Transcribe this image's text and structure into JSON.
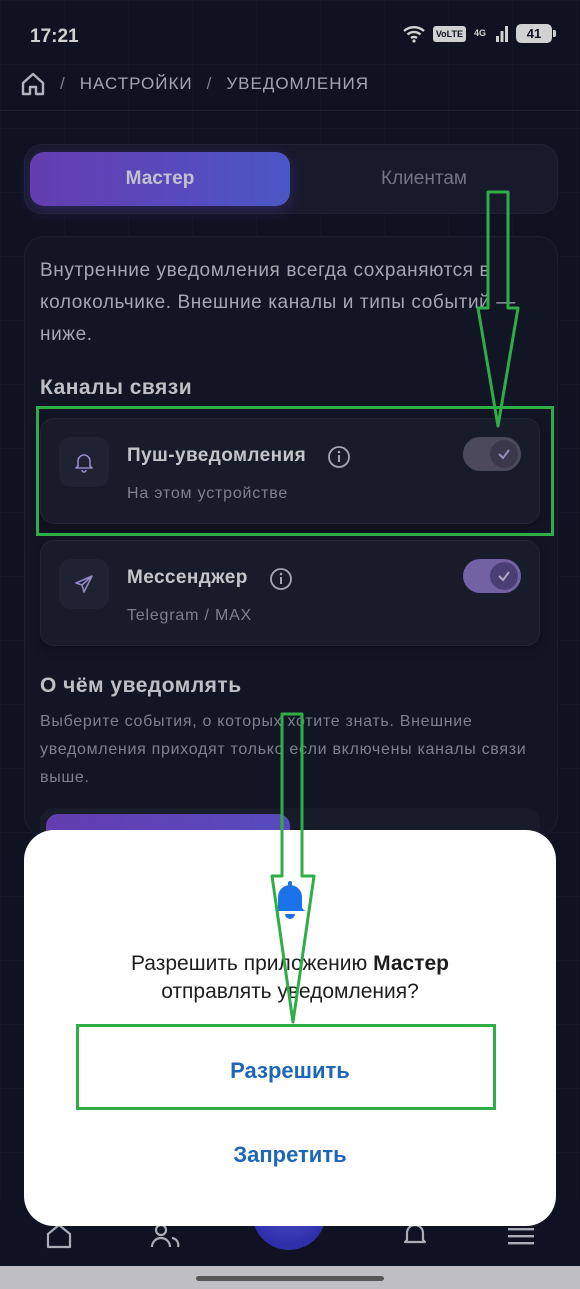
{
  "status_bar": {
    "time": "17:21",
    "volte": "VoLTE",
    "network": "4G",
    "battery": "41"
  },
  "breadcrumb": {
    "home_icon": "home-icon",
    "separator": "/",
    "items": [
      "НАСТРОЙКИ",
      "УВЕДОМЛЕНИЯ"
    ]
  },
  "tabs": [
    {
      "label": "Мастер",
      "active": true
    },
    {
      "label": "Клиентам",
      "active": false
    }
  ],
  "intro_text": "Внутренние уведомления всегда сохраняются в колокольчике. Внешние каналы и типы событий — ниже.",
  "channels": {
    "title": "Каналы связи",
    "items": [
      {
        "icon": "bell-icon",
        "title": "Пуш-уведомления",
        "subtitle": "На этом устройстве",
        "enabled": true
      },
      {
        "icon": "send-icon",
        "title": "Мессенджер",
        "subtitle": "Telegram / MAX",
        "enabled": true
      }
    ]
  },
  "events": {
    "title": "О чём уведомлять",
    "description": "Выберите события, о которых хотите знать. Внешние уведомления приходят только если включены каналы связи выше."
  },
  "permission_dialog": {
    "icon": "bell-icon",
    "text_prefix": "Разрешить приложению ",
    "app_name": "Мастер",
    "text_suffix": "отправлять уведомления?",
    "allow_label": "Разрешить",
    "deny_label": "Запретить"
  },
  "colors": {
    "accent_purple": "#7a4bd6",
    "dialog_button_blue": "#1e66b8",
    "annotation_green": "#2fae47",
    "bell_blue": "#1a73e8"
  }
}
